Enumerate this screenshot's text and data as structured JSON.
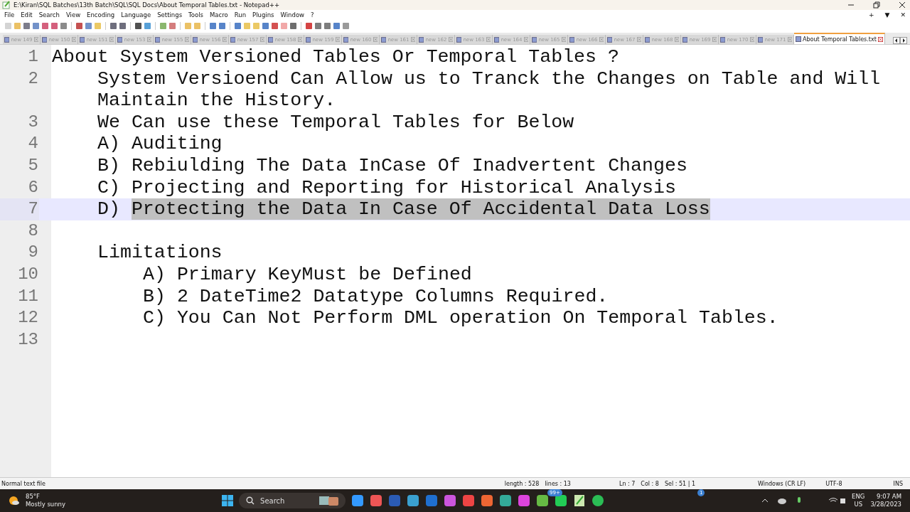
{
  "window": {
    "title": "E:\\Kiran\\SQL Batches\\13th Batch\\SQL\\SQL Docs\\About Temporal Tables.txt - Notepad++"
  },
  "menu": [
    "File",
    "Edit",
    "Search",
    "View",
    "Encoding",
    "Language",
    "Settings",
    "Tools",
    "Macro",
    "Run",
    "Plugins",
    "Window",
    "?"
  ],
  "tab_actions": [
    "+",
    "▼",
    "✕"
  ],
  "tabs": [
    {
      "label": "new 149",
      "selected": false
    },
    {
      "label": "new 150",
      "selected": false
    },
    {
      "label": "new 151",
      "selected": false
    },
    {
      "label": "new 153",
      "selected": false
    },
    {
      "label": "new 155",
      "selected": false
    },
    {
      "label": "new 156",
      "selected": false
    },
    {
      "label": "new 157",
      "selected": false
    },
    {
      "label": "new 158",
      "selected": false
    },
    {
      "label": "new 159",
      "selected": false
    },
    {
      "label": "new 160",
      "selected": false
    },
    {
      "label": "new 161",
      "selected": false
    },
    {
      "label": "new 162",
      "selected": false
    },
    {
      "label": "new 163",
      "selected": false
    },
    {
      "label": "new 164",
      "selected": false
    },
    {
      "label": "new 165",
      "selected": false
    },
    {
      "label": "new 166",
      "selected": false
    },
    {
      "label": "new 167",
      "selected": false
    },
    {
      "label": "new 168",
      "selected": false
    },
    {
      "label": "new 169",
      "selected": false
    },
    {
      "label": "new 170",
      "selected": false
    },
    {
      "label": "new 171",
      "selected": false
    },
    {
      "label": "About Temporal Tables.txt",
      "selected": true
    }
  ],
  "editor": {
    "lines": [
      {
        "number": "1",
        "kind": "top",
        "text": "About System Versioned Tables Or Temporal Tables ?",
        "current": false
      },
      {
        "number": "2",
        "kind": "item",
        "text": "System Versioend Can Allow us to Tranck the Changes on Table and Will Maintain the History.",
        "current": false
      },
      {
        "number": "3",
        "kind": "item",
        "text": "We Can use these Temporal Tables for Below",
        "current": false
      },
      {
        "number": "4",
        "kind": "item",
        "text": "A) Auditing",
        "current": false
      },
      {
        "number": "5",
        "kind": "item",
        "text": "B) Rebiulding The Data InCase Of Inadvertent Changes",
        "current": false
      },
      {
        "number": "6",
        "kind": "item",
        "text": "C) Projecting and Reporting for Historical Analysis",
        "current": false
      },
      {
        "number": "7",
        "kind": "item",
        "text": "D) ",
        "selected_text": "Protecting the Data In Case Of Accidental Data Loss",
        "current": true
      },
      {
        "number": "8",
        "kind": "item",
        "current": false
      },
      {
        "number": "9",
        "kind": "item",
        "text": "Limitations",
        "current": false
      },
      {
        "number": "10",
        "kind": "sub",
        "text": "A) Primary KeyMust be Defined",
        "current": false
      },
      {
        "number": "11",
        "kind": "sub",
        "text": "B) 2 DateTime2 Datatype Columns Required.",
        "current": false
      },
      {
        "number": "12",
        "kind": "sub",
        "text": "C) You Can Not Perform DML operation On Temporal Tables.",
        "current": false
      },
      {
        "number": "13",
        "kind": "sub",
        "current": false
      }
    ]
  },
  "status_bar": {
    "file_type": "Normal text file",
    "length": "length : 528",
    "lines": "lines : 13",
    "position": "Ln : 7",
    "column": "Col : 8",
    "selection": "Sel : 51 | 1",
    "eol": "Windows (CR LF)",
    "encoding": "UTF-8",
    "mode": "INS"
  },
  "taskbar": {
    "temperature": "85°F",
    "weather": "Mostly sunny",
    "search": "Search",
    "badges": [
      "99+",
      "1"
    ],
    "language": "ENG",
    "region": "US",
    "time": "9:07 AM",
    "date": "3/28/2023"
  }
}
